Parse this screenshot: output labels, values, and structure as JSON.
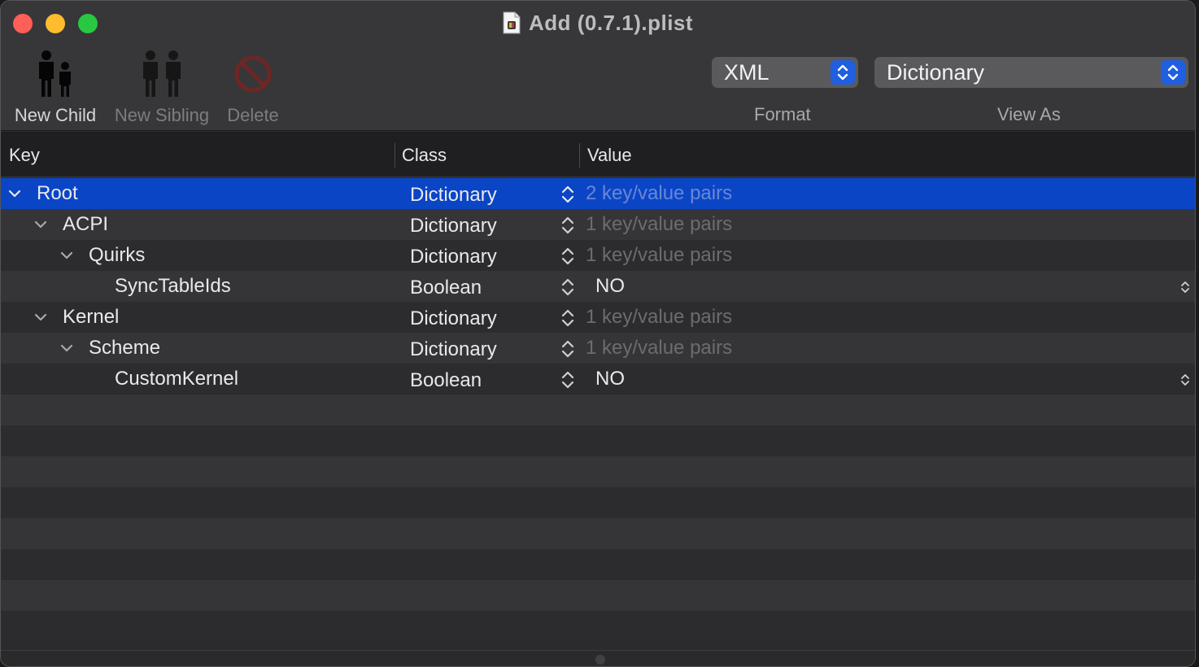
{
  "window": {
    "title": "Add (0.7.1).plist"
  },
  "toolbar": {
    "new_child_label": "New Child",
    "new_sibling_label": "New Sibling",
    "delete_label": "Delete",
    "format_value": "XML",
    "format_caption": "Format",
    "view_as_value": "Dictionary",
    "view_as_caption": "View As"
  },
  "columns": {
    "key": "Key",
    "class": "Class",
    "value": "Value"
  },
  "rows": [
    {
      "key": "Root",
      "class": "Dictionary",
      "value": "2 key/value pairs"
    },
    {
      "key": "ACPI",
      "class": "Dictionary",
      "value": "1 key/value pairs"
    },
    {
      "key": "Quirks",
      "class": "Dictionary",
      "value": "1 key/value pairs"
    },
    {
      "key": "SyncTableIds",
      "class": "Boolean",
      "value": "NO"
    },
    {
      "key": "Kernel",
      "class": "Dictionary",
      "value": "1 key/value pairs"
    },
    {
      "key": "Scheme",
      "class": "Dictionary",
      "value": "1 key/value pairs"
    },
    {
      "key": "CustomKernel",
      "class": "Boolean",
      "value": "NO"
    }
  ],
  "colors": {
    "selection": "#0a45c6",
    "accent": "#1f5fe0",
    "close": "#fe5f57",
    "minimize": "#febc2e",
    "zoom": "#28c840"
  }
}
